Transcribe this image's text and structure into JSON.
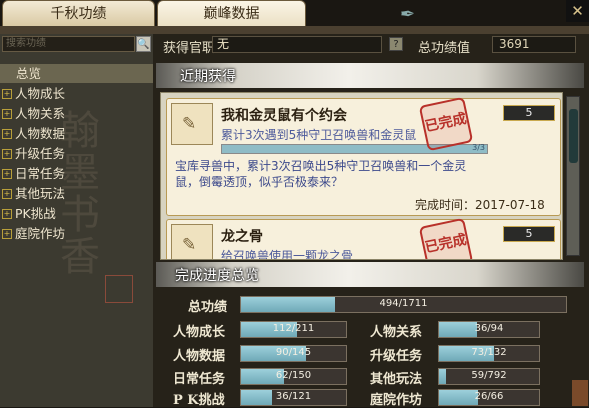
{
  "tabs": [
    {
      "label": "千秋功绩",
      "active": false
    },
    {
      "label": "巅峰数据",
      "active": true
    }
  ],
  "sidebar": {
    "search_placeholder": "搜索功绩",
    "items": [
      {
        "label": "总览",
        "selected": true,
        "expandable": false
      },
      {
        "label": "人物成长",
        "expandable": true
      },
      {
        "label": "人物关系",
        "expandable": true
      },
      {
        "label": "人物数据",
        "expandable": true
      },
      {
        "label": "升级任务",
        "expandable": true
      },
      {
        "label": "日常任务",
        "expandable": true
      },
      {
        "label": "其他玩法",
        "expandable": true
      },
      {
        "label": "PK挑战",
        "expandable": true
      },
      {
        "label": "庭院作坊",
        "expandable": true
      }
    ]
  },
  "header": {
    "official_label": "获得官职",
    "official_value": "无",
    "help_label": "?",
    "total_label": "总功绩值",
    "total_value": "3691"
  },
  "recent": {
    "title": "近期获得",
    "items": [
      {
        "title": "我和金灵鼠有个约会",
        "desc": "累计3次遇到5种守卫召唤兽和金灵鼠",
        "progress_text": "3/3",
        "progress": 1.0,
        "body": "宝库寻兽中，累计3次召唤出5种守卫召唤兽和一个金灵鼠，倒霉透顶，似乎否极泰来？",
        "time": "完成时间：2017-07-18",
        "points": "5",
        "stamp": "已完成"
      },
      {
        "title": "龙之骨",
        "desc": "给召唤兽使用一颗龙之骨",
        "points": "5",
        "stamp": "已完成"
      }
    ]
  },
  "overview": {
    "title": "完成进度总览",
    "total": {
      "label": "总功绩",
      "text": "494/1711",
      "value": 494,
      "max": 1711
    },
    "rows": [
      {
        "label": "人物成长",
        "text": "112/211",
        "value": 112,
        "max": 211
      },
      {
        "label": "人物关系",
        "text": "36/94",
        "value": 36,
        "max": 94
      },
      {
        "label": "人物数据",
        "text": "90/145",
        "value": 90,
        "max": 145
      },
      {
        "label": "升级任务",
        "text": "73/132",
        "value": 73,
        "max": 132
      },
      {
        "label": "日常任务",
        "text": "62/150",
        "value": 62,
        "max": 150
      },
      {
        "label": "其他玩法",
        "text": "59/792",
        "value": 59,
        "max": 792
      },
      {
        "label": "P K挑战",
        "text": "36/121",
        "value": 36,
        "max": 121
      },
      {
        "label": "庭院作坊",
        "text": "26/66",
        "value": 26,
        "max": 66
      }
    ]
  },
  "colors": {
    "bar_fill": "#8fc3cf",
    "stamp": "#b8312a",
    "desc_text": "#4d5a9b"
  },
  "icons": [
    "brush-cursor-icon",
    "close-icon",
    "search-icon",
    "expand-plus-icon",
    "scroll-icon"
  ]
}
